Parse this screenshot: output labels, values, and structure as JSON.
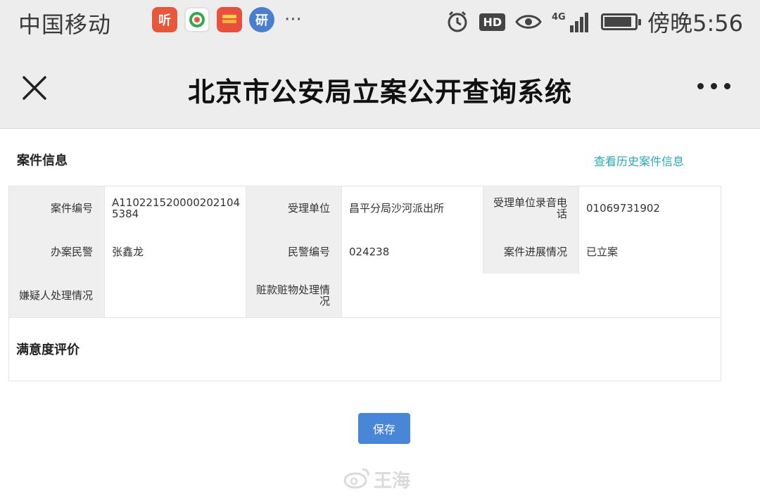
{
  "status_bar": {
    "carrier": "中国移动",
    "app_icons": [
      {
        "name": "ting-app-icon",
        "label": "听"
      },
      {
        "name": "browser-app-icon",
        "label": ""
      },
      {
        "name": "huawei-app-icon",
        "label": ""
      },
      {
        "name": "yan-app-icon",
        "label": "研"
      }
    ],
    "more": "···",
    "hd": "HD",
    "network": "4G",
    "time": "傍晚5:56",
    "battery_level_pct": 90
  },
  "nav": {
    "title": "北京市公安局立案公开查询系统"
  },
  "case_section": {
    "title": "案件信息",
    "history_link": "查看历史案件信息",
    "rows": [
      [
        {
          "label": "案件编号",
          "value": "A1102215200002021045384"
        },
        {
          "label": "受理单位",
          "value": "昌平分局沙河派出所"
        },
        {
          "label": "受理单位录音电话",
          "value": "01069731902"
        }
      ],
      [
        {
          "label": "办案民警",
          "value": "张鑫龙"
        },
        {
          "label": "民警编号",
          "value": "024238"
        },
        {
          "label": "案件进展情况",
          "value": "已立案"
        }
      ],
      [
        {
          "label": "嫌疑人处理情况",
          "value": ""
        },
        {
          "label": "赃款赃物处理情况",
          "value": ""
        }
      ]
    ],
    "satisfaction_title": "满意度评价"
  },
  "save_label": "保存",
  "watermark": "王海",
  "colors": {
    "accent": "#4a86d8",
    "link": "#2aa7b8",
    "label_bg": "#efefef",
    "chrome_bg": "#ededed"
  }
}
